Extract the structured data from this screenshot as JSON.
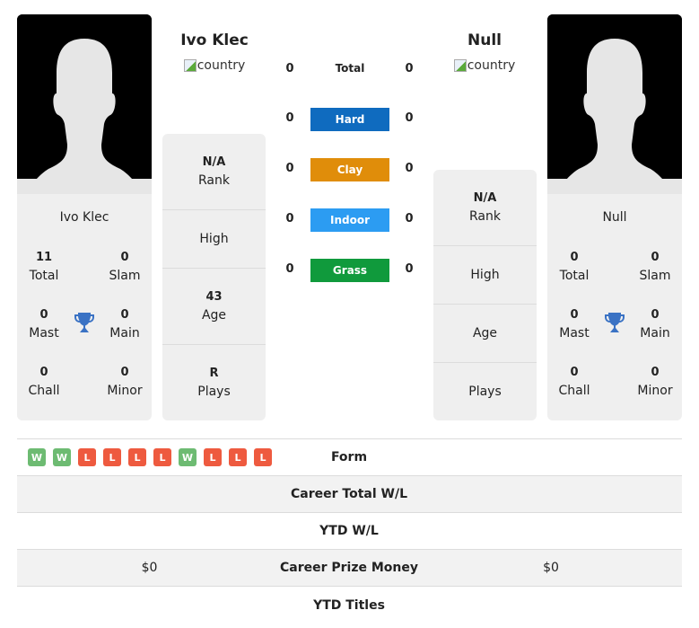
{
  "player1": {
    "name": "Ivo Klec",
    "flag_alt": "country",
    "card_name": "Ivo Klec",
    "titles": {
      "total": {
        "value": "11",
        "label": "Total"
      },
      "slam": {
        "value": "0",
        "label": "Slam"
      },
      "mast": {
        "value": "0",
        "label": "Mast"
      },
      "main": {
        "value": "0",
        "label": "Main"
      },
      "chall": {
        "value": "0",
        "label": "Chall"
      },
      "minor": {
        "value": "0",
        "label": "Minor"
      }
    },
    "info": {
      "rank": {
        "value": "N/A",
        "label": "Rank"
      },
      "high": {
        "value": "",
        "label": "High"
      },
      "age": {
        "value": "43",
        "label": "Age"
      },
      "plays": {
        "value": "R",
        "label": "Plays"
      }
    }
  },
  "player2": {
    "name": "Null",
    "flag_alt": "country",
    "card_name": "Null",
    "titles": {
      "total": {
        "value": "0",
        "label": "Total"
      },
      "slam": {
        "value": "0",
        "label": "Slam"
      },
      "mast": {
        "value": "0",
        "label": "Mast"
      },
      "main": {
        "value": "0",
        "label": "Main"
      },
      "chall": {
        "value": "0",
        "label": "Chall"
      },
      "minor": {
        "value": "0",
        "label": "Minor"
      }
    },
    "info": {
      "rank": {
        "value": "N/A",
        "label": "Rank"
      },
      "high": {
        "value": "",
        "label": "High"
      },
      "age": {
        "value": "",
        "label": "Age"
      },
      "plays": {
        "value": "",
        "label": "Plays"
      }
    }
  },
  "surfaces": [
    {
      "label": "Total",
      "p1": "0",
      "p2": "0",
      "color": ""
    },
    {
      "label": "Hard",
      "p1": "0",
      "p2": "0",
      "color": "#0f6bbf"
    },
    {
      "label": "Clay",
      "p1": "0",
      "p2": "0",
      "color": "#e08d0a"
    },
    {
      "label": "Indoor",
      "p1": "0",
      "p2": "0",
      "color": "#2c9cf2"
    },
    {
      "label": "Grass",
      "p1": "0",
      "p2": "0",
      "color": "#109a3c"
    }
  ],
  "form": [
    "W",
    "W",
    "L",
    "L",
    "L",
    "L",
    "W",
    "L",
    "L",
    "L"
  ],
  "form_colors": {
    "W": "#6dbb72",
    "L": "#ee5a3f"
  },
  "table": {
    "rows": [
      {
        "label": "Form",
        "left": "",
        "right": ""
      },
      {
        "label": "Career Total W/L",
        "left": "",
        "right": ""
      },
      {
        "label": "YTD W/L",
        "left": "",
        "right": ""
      },
      {
        "label": "Career Prize Money",
        "left": "$0",
        "right": "$0"
      },
      {
        "label": "YTD Titles",
        "left": "",
        "right": ""
      }
    ]
  },
  "colors": {
    "trophy": "#3a72c4",
    "card_bg": "#efefef"
  }
}
